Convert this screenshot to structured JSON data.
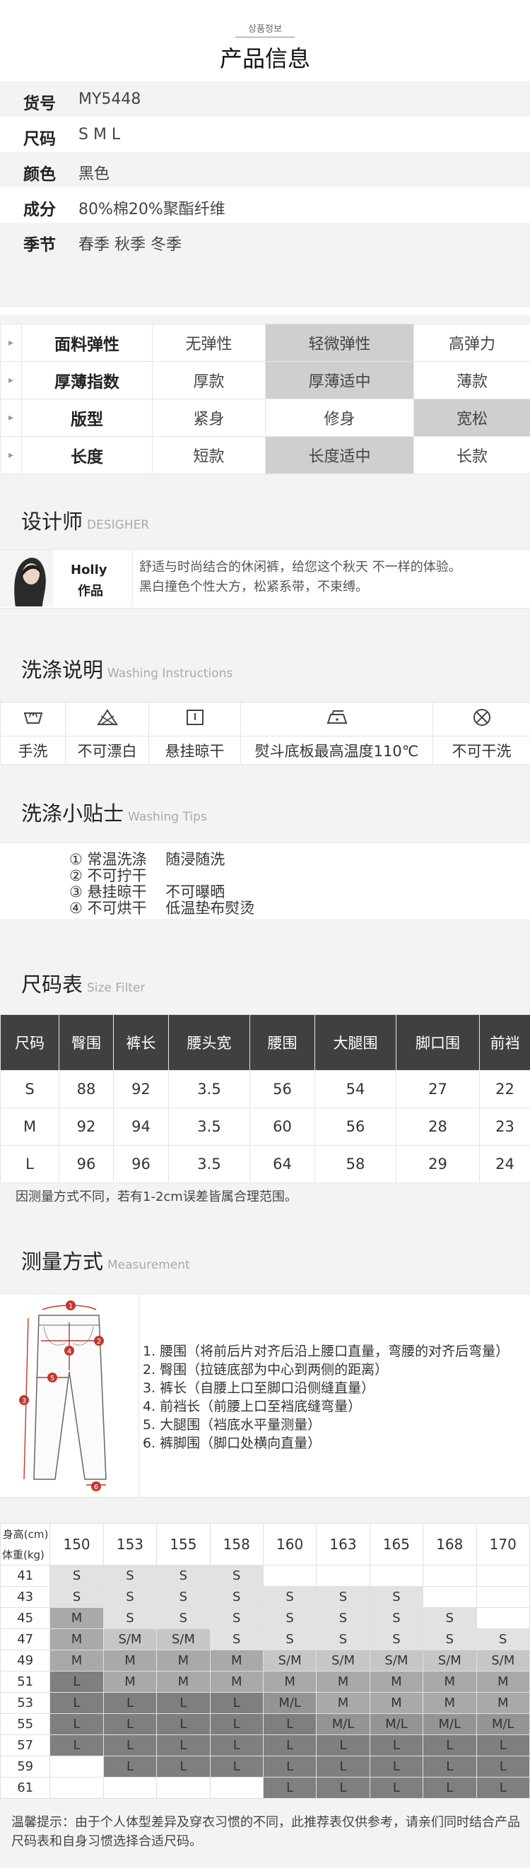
{
  "header": {
    "small": "상품정보",
    "title": "产品信息"
  },
  "specs": [
    {
      "label": "货号",
      "value": "MY5448"
    },
    {
      "label": "尺码",
      "value": "S M L"
    },
    {
      "label": "颜色",
      "value": "黑色"
    },
    {
      "label": "成分",
      "value": "80%棉20%聚酯纤维"
    },
    {
      "label": "季节",
      "value": "春季 秋季 冬季"
    }
  ],
  "attributes": [
    {
      "label": "面料弹性",
      "options": [
        "无弹性",
        "轻微弹性",
        "高弹力"
      ],
      "selected": 1
    },
    {
      "label": "厚薄指数",
      "options": [
        "厚款",
        "厚薄适中",
        "薄款"
      ],
      "selected": 1
    },
    {
      "label": "版型",
      "options": [
        "紧身",
        "修身",
        "宽松"
      ],
      "selected": 2
    },
    {
      "label": "长度",
      "options": [
        "短款",
        "长度适中",
        "长款"
      ],
      "selected": 1
    }
  ],
  "designer": {
    "title": "设计师",
    "subtitle": "DESIGHER",
    "name": "Holly",
    "work": "作品",
    "text1": "舒适与时尚结合的休闲裤，给您这个秋天 不一样的体验。",
    "text2": "黑白撞色个性大方，松紧系带，不束缚。"
  },
  "washing": {
    "title": "洗涤说明",
    "subtitle": "Washing Instructions",
    "items": [
      {
        "icon": "hand-wash-icon",
        "label": "手洗"
      },
      {
        "icon": "no-bleach-icon",
        "label": "不可漂白"
      },
      {
        "icon": "hang-dry-icon",
        "label": "悬挂晾干"
      },
      {
        "icon": "iron-icon",
        "label": "熨斗底板最高温度110℃"
      },
      {
        "icon": "no-dry-clean-icon",
        "label": "不可干洗"
      }
    ]
  },
  "tips": {
    "title": "洗涤小贴士",
    "subtitle": "Washing Tips",
    "lines": [
      "① 常温洗涤    随浸随洗",
      "② 不可拧干",
      "③ 悬挂晾干    不可曝晒",
      "④ 不可烘干    低温垫布熨烫"
    ]
  },
  "size_table": {
    "title": "尺码表",
    "subtitle": "Size Filter",
    "headers": [
      "尺码",
      "臀围",
      "裤长",
      "腰头宽",
      "腰围",
      "大腿围",
      "脚口围",
      "前裆"
    ],
    "rows": [
      [
        "S",
        "88",
        "92",
        "3.5",
        "56",
        "54",
        "27",
        "22"
      ],
      [
        "M",
        "92",
        "94",
        "3.5",
        "60",
        "56",
        "28",
        "23"
      ],
      [
        "L",
        "96",
        "96",
        "3.5",
        "64",
        "58",
        "29",
        "24"
      ]
    ],
    "note": "因测量方式不同，若有1-2cm误差皆属合理范围。"
  },
  "measurement": {
    "title": "测量方式",
    "subtitle": "Measurement",
    "items": [
      "1. 腰围（将前后片对齐后沿上腰口直量，弯腰的对齐后弯量）",
      "2. 臀围（拉链底部为中心到两侧的距离）",
      "3. 裤长（自腰上口至脚口沿侧缝直量）",
      "4. 前裆长（前腰上口至裆底缝弯量）",
      "5. 大腿围（裆底水平量测量）",
      "6. 裤脚围（脚口处横向直量）"
    ]
  },
  "fit_grid": {
    "height_label": "身高(cm)",
    "weight_label": "体重(kg)",
    "heights": [
      "150",
      "153",
      "155",
      "158",
      "160",
      "163",
      "165",
      "168",
      "170"
    ],
    "rows": [
      {
        "w": "41",
        "c": [
          "S",
          "S",
          "S",
          "S",
          "",
          "",
          "",
          "",
          ""
        ]
      },
      {
        "w": "43",
        "c": [
          "S",
          "S",
          "S",
          "S",
          "S",
          "S",
          "S",
          "",
          ""
        ]
      },
      {
        "w": "45",
        "c": [
          "M",
          "S",
          "S",
          "S",
          "S",
          "S",
          "S",
          "S",
          ""
        ]
      },
      {
        "w": "47",
        "c": [
          "M",
          "S/M",
          "S/M",
          "S",
          "S",
          "S",
          "S",
          "S",
          "S"
        ]
      },
      {
        "w": "49",
        "c": [
          "M",
          "M",
          "M",
          "M",
          "S/M",
          "S/M",
          "S/M",
          "S/M",
          "S/M"
        ]
      },
      {
        "w": "51",
        "c": [
          "L",
          "M",
          "M",
          "M",
          "M",
          "M",
          "M",
          "M",
          "M"
        ]
      },
      {
        "w": "53",
        "c": [
          "L",
          "L",
          "L",
          "L",
          "M/L",
          "M",
          "M",
          "M",
          "M"
        ]
      },
      {
        "w": "55",
        "c": [
          "L",
          "L",
          "L",
          "L",
          "L",
          "M/L",
          "M/L",
          "M/L",
          "M/L"
        ]
      },
      {
        "w": "57",
        "c": [
          "L",
          "L",
          "L",
          "L",
          "L",
          "L",
          "L",
          "L",
          "L"
        ]
      },
      {
        "w": "59",
        "c": [
          "",
          "L",
          "L",
          "L",
          "L",
          "L",
          "L",
          "L",
          "L"
        ]
      },
      {
        "w": "61",
        "c": [
          "",
          "",
          "",
          "",
          "L",
          "L",
          "L",
          "L",
          "L"
        ]
      }
    ],
    "note": "温馨提示：由于个人体型差异及穿衣习惯的不同，此推荐表仅供参考，请亲们同时结合产品尺码表和自身习惯选择合适尺码。"
  }
}
